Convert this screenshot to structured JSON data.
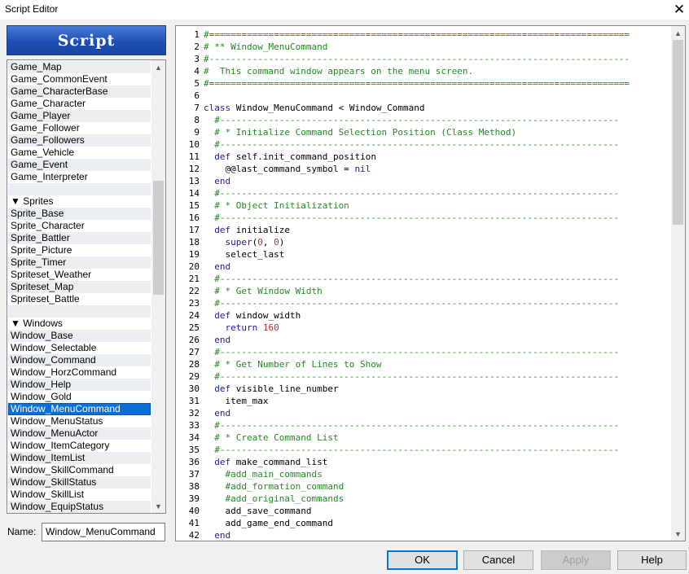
{
  "window": {
    "title": "Script Editor",
    "close_glyph": "✕"
  },
  "header": {
    "label": "Script"
  },
  "script_list": [
    {
      "label": "Game_Map",
      "type": "item"
    },
    {
      "label": "Game_CommonEvent",
      "type": "item"
    },
    {
      "label": "Game_CharacterBase",
      "type": "item"
    },
    {
      "label": "Game_Character",
      "type": "item"
    },
    {
      "label": "Game_Player",
      "type": "item"
    },
    {
      "label": "Game_Follower",
      "type": "item"
    },
    {
      "label": "Game_Followers",
      "type": "item"
    },
    {
      "label": "Game_Vehicle",
      "type": "item"
    },
    {
      "label": "Game_Event",
      "type": "item"
    },
    {
      "label": "Game_Interpreter",
      "type": "item"
    },
    {
      "label": "",
      "type": "blank"
    },
    {
      "label": "▼ Sprites",
      "type": "group"
    },
    {
      "label": "Sprite_Base",
      "type": "item"
    },
    {
      "label": "Sprite_Character",
      "type": "item"
    },
    {
      "label": "Sprite_Battler",
      "type": "item"
    },
    {
      "label": "Sprite_Picture",
      "type": "item"
    },
    {
      "label": "Sprite_Timer",
      "type": "item"
    },
    {
      "label": "Spriteset_Weather",
      "type": "item"
    },
    {
      "label": "Spriteset_Map",
      "type": "item"
    },
    {
      "label": "Spriteset_Battle",
      "type": "item"
    },
    {
      "label": "",
      "type": "blank"
    },
    {
      "label": "▼ Windows",
      "type": "group"
    },
    {
      "label": "Window_Base",
      "type": "item"
    },
    {
      "label": "Window_Selectable",
      "type": "item"
    },
    {
      "label": "Window_Command",
      "type": "item"
    },
    {
      "label": "Window_HorzCommand",
      "type": "item"
    },
    {
      "label": "Window_Help",
      "type": "item"
    },
    {
      "label": "Window_Gold",
      "type": "item"
    },
    {
      "label": "Window_MenuCommand",
      "type": "selected"
    },
    {
      "label": "Window_MenuStatus",
      "type": "item"
    },
    {
      "label": "Window_MenuActor",
      "type": "item"
    },
    {
      "label": "Window_ItemCategory",
      "type": "item"
    },
    {
      "label": "Window_ItemList",
      "type": "item"
    },
    {
      "label": "Window_SkillCommand",
      "type": "item"
    },
    {
      "label": "Window_SkillStatus",
      "type": "item"
    },
    {
      "label": "Window_SkillList",
      "type": "item"
    },
    {
      "label": "Window_EquipStatus",
      "type": "item"
    }
  ],
  "name_field": {
    "label": "Name:",
    "value": "Window_MenuCommand"
  },
  "code_lines": [
    {
      "n": "1",
      "segs": [
        [
          "#==============================================================================",
          "comment"
        ]
      ]
    },
    {
      "n": "2",
      "segs": [
        [
          "# ** Window_MenuCommand",
          "comment"
        ]
      ]
    },
    {
      "n": "3",
      "segs": [
        [
          "#------------------------------------------------------------------------------",
          "comment"
        ]
      ]
    },
    {
      "n": "4",
      "segs": [
        [
          "#  This command window appears on the menu screen.",
          "comment"
        ]
      ]
    },
    {
      "n": "5",
      "segs": [
        [
          "#==============================================================================",
          "comment"
        ]
      ]
    },
    {
      "n": "6",
      "segs": []
    },
    {
      "n": "7",
      "segs": [
        [
          "class ",
          "keyword"
        ],
        [
          "Window_MenuCommand < Window_Command",
          "plain"
        ]
      ]
    },
    {
      "n": "8",
      "segs": [
        [
          "  #--------------------------------------------------------------------------",
          "comment"
        ]
      ]
    },
    {
      "n": "9",
      "segs": [
        [
          "  # * Initialize Command Selection Position (Class Method)",
          "comment"
        ]
      ]
    },
    {
      "n": "10",
      "segs": [
        [
          "  #--------------------------------------------------------------------------",
          "comment"
        ]
      ]
    },
    {
      "n": "11",
      "segs": [
        [
          "  def ",
          "keyword"
        ],
        [
          "self.init_command_position",
          "plain"
        ]
      ]
    },
    {
      "n": "12",
      "segs": [
        [
          "    @@last_command_symbol = ",
          "plain"
        ],
        [
          "nil",
          "keyword"
        ]
      ]
    },
    {
      "n": "13",
      "segs": [
        [
          "  end",
          "keyword"
        ]
      ]
    },
    {
      "n": "14",
      "segs": [
        [
          "  #--------------------------------------------------------------------------",
          "comment"
        ]
      ]
    },
    {
      "n": "15",
      "segs": [
        [
          "  # * Object Initialization",
          "comment"
        ]
      ]
    },
    {
      "n": "16",
      "segs": [
        [
          "  #--------------------------------------------------------------------------",
          "comment"
        ]
      ]
    },
    {
      "n": "17",
      "segs": [
        [
          "  def ",
          "keyword"
        ],
        [
          "initialize",
          "plain"
        ]
      ]
    },
    {
      "n": "18",
      "segs": [
        [
          "    super",
          "keyword"
        ],
        [
          "(",
          "plain"
        ],
        [
          "0",
          "number"
        ],
        [
          ", ",
          "plain"
        ],
        [
          "0",
          "number"
        ],
        [
          ")",
          "plain"
        ]
      ]
    },
    {
      "n": "19",
      "segs": [
        [
          "    select_last",
          "plain"
        ]
      ]
    },
    {
      "n": "20",
      "segs": [
        [
          "  end",
          "keyword"
        ]
      ]
    },
    {
      "n": "21",
      "segs": [
        [
          "  #--------------------------------------------------------------------------",
          "comment"
        ]
      ]
    },
    {
      "n": "22",
      "segs": [
        [
          "  # * Get Window Width",
          "comment"
        ]
      ]
    },
    {
      "n": "23",
      "segs": [
        [
          "  #--------------------------------------------------------------------------",
          "comment"
        ]
      ]
    },
    {
      "n": "24",
      "segs": [
        [
          "  def ",
          "keyword"
        ],
        [
          "window_width",
          "plain"
        ]
      ]
    },
    {
      "n": "25",
      "segs": [
        [
          "    return ",
          "keyword"
        ],
        [
          "160",
          "number"
        ]
      ]
    },
    {
      "n": "26",
      "segs": [
        [
          "  end",
          "keyword"
        ]
      ]
    },
    {
      "n": "27",
      "segs": [
        [
          "  #--------------------------------------------------------------------------",
          "comment"
        ]
      ]
    },
    {
      "n": "28",
      "segs": [
        [
          "  # * Get Number of Lines to Show",
          "comment"
        ]
      ]
    },
    {
      "n": "29",
      "segs": [
        [
          "  #--------------------------------------------------------------------------",
          "comment"
        ]
      ]
    },
    {
      "n": "30",
      "segs": [
        [
          "  def ",
          "keyword"
        ],
        [
          "visible_line_number",
          "plain"
        ]
      ]
    },
    {
      "n": "31",
      "segs": [
        [
          "    item_max",
          "plain"
        ]
      ]
    },
    {
      "n": "32",
      "segs": [
        [
          "  end",
          "keyword"
        ]
      ]
    },
    {
      "n": "33",
      "segs": [
        [
          "  #--------------------------------------------------------------------------",
          "comment"
        ]
      ]
    },
    {
      "n": "34",
      "segs": [
        [
          "  # * Create Command List",
          "comment"
        ]
      ]
    },
    {
      "n": "35",
      "segs": [
        [
          "  #--------------------------------------------------------------------------",
          "comment"
        ]
      ]
    },
    {
      "n": "36",
      "segs": [
        [
          "  def ",
          "keyword"
        ],
        [
          "make_command_list",
          "plain"
        ]
      ]
    },
    {
      "n": "37",
      "segs": [
        [
          "    #add_main_commands",
          "comment"
        ]
      ]
    },
    {
      "n": "38",
      "segs": [
        [
          "    #add_formation_command",
          "comment"
        ]
      ]
    },
    {
      "n": "39",
      "segs": [
        [
          "    #add_original_commands",
          "comment"
        ]
      ]
    },
    {
      "n": "40",
      "segs": [
        [
          "    add_save_command",
          "plain"
        ]
      ]
    },
    {
      "n": "41",
      "segs": [
        [
          "    add_game_end_command",
          "plain"
        ]
      ]
    },
    {
      "n": "42",
      "segs": [
        [
          "  end",
          "keyword"
        ]
      ]
    }
  ],
  "buttons": {
    "ok": "OK",
    "cancel": "Cancel",
    "apply": "Apply",
    "help": "Help"
  },
  "colors": {
    "comment": "#228b22",
    "keyword": "#1a1aa6",
    "number": "#b03030",
    "selection": "#0a6fd8",
    "header": "#1f4fb5"
  },
  "scroll": {
    "list_thumb_fraction": 0.27,
    "list_thumb_start": 0.25,
    "editor_thumb_fraction": 0.38,
    "editor_thumb_start": 0.0
  }
}
